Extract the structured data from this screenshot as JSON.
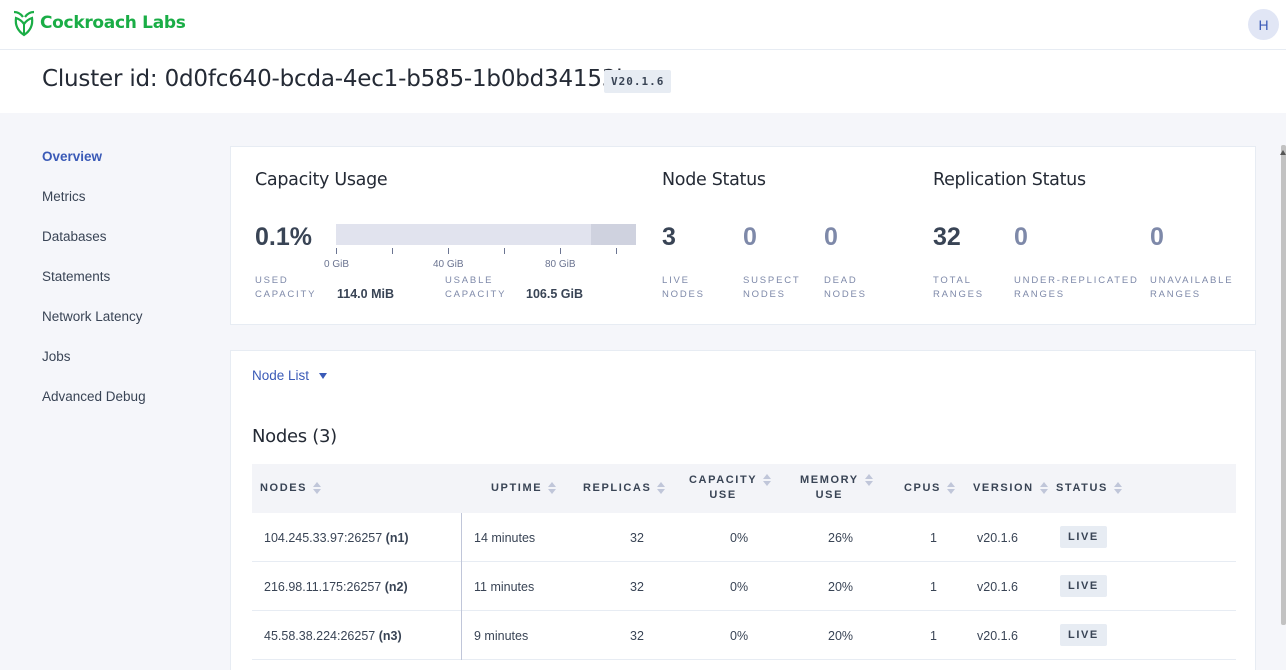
{
  "topbar": {
    "logo_text": "Cockroach Labs",
    "avatar_initial": "H"
  },
  "header": {
    "cluster_title": "Cluster id: 0d0fc640-bcda-4ec1-b585-1b0bd34153bc",
    "version_badge": "V20.1.6"
  },
  "sidebar": {
    "items": [
      {
        "label": "Overview",
        "active": true
      },
      {
        "label": "Metrics"
      },
      {
        "label": "Databases"
      },
      {
        "label": "Statements"
      },
      {
        "label": "Network Latency"
      },
      {
        "label": "Jobs"
      },
      {
        "label": "Advanced Debug"
      }
    ]
  },
  "capacity": {
    "title": "Capacity Usage",
    "percent": "0.1%",
    "bar_ticks": [
      "0 GiB",
      "40 GiB",
      "80 GiB"
    ],
    "used_label": "USED CAPACITY",
    "used_label_line1": "USED",
    "used_label_line2": "CAPACITY",
    "used_value": "114.0 MiB",
    "usable_label_line1": "USABLE",
    "usable_label_line2": "CAPACITY",
    "usable_value": "106.5 GiB"
  },
  "node_status": {
    "title": "Node Status",
    "live": {
      "value": "3",
      "line1": "LIVE",
      "line2": "NODES"
    },
    "suspect": {
      "value": "0",
      "line1": "SUSPECT",
      "line2": "NODES"
    },
    "dead": {
      "value": "0",
      "line1": "DEAD",
      "line2": "NODES"
    }
  },
  "replication_status": {
    "title": "Replication Status",
    "total": {
      "value": "32",
      "line1": "TOTAL",
      "line2": "RANGES"
    },
    "under": {
      "value": "0",
      "line1": "UNDER-REPLICATED",
      "line2": "RANGES"
    },
    "unavailable": {
      "value": "0",
      "line1": "UNAVAILABLE",
      "line2": "RANGES"
    }
  },
  "node_list": {
    "selector_label": "Node List",
    "title": "Nodes (3)",
    "columns": {
      "nodes": "NODES",
      "uptime": "UPTIME",
      "replicas": "REPLICAS",
      "capacity_1": "CAPACITY",
      "capacity_2": "USE",
      "memory_1": "MEMORY",
      "memory_2": "USE",
      "cpus": "CPUS",
      "version": "VERSION",
      "status": "STATUS"
    },
    "rows": [
      {
        "address": "104.245.33.97:26257",
        "node_id": "(n1)",
        "uptime": "14 minutes",
        "replicas": "32",
        "capacity": "0%",
        "memory": "26%",
        "cpus": "1",
        "version": "v20.1.6",
        "status": "LIVE"
      },
      {
        "address": "216.98.11.175:26257",
        "node_id": "(n2)",
        "uptime": "11 minutes",
        "replicas": "32",
        "capacity": "0%",
        "memory": "20%",
        "cpus": "1",
        "version": "v20.1.6",
        "status": "LIVE"
      },
      {
        "address": "45.58.38.224:26257",
        "node_id": "(n3)",
        "uptime": "9 minutes",
        "replicas": "32",
        "capacity": "0%",
        "memory": "20%",
        "cpus": "1",
        "version": "v20.1.6",
        "status": "LIVE"
      }
    ]
  },
  "colors": {
    "brand_green": "#1aad46",
    "accent_blue": "#3a5ab7",
    "background": "#f5f6fa"
  }
}
